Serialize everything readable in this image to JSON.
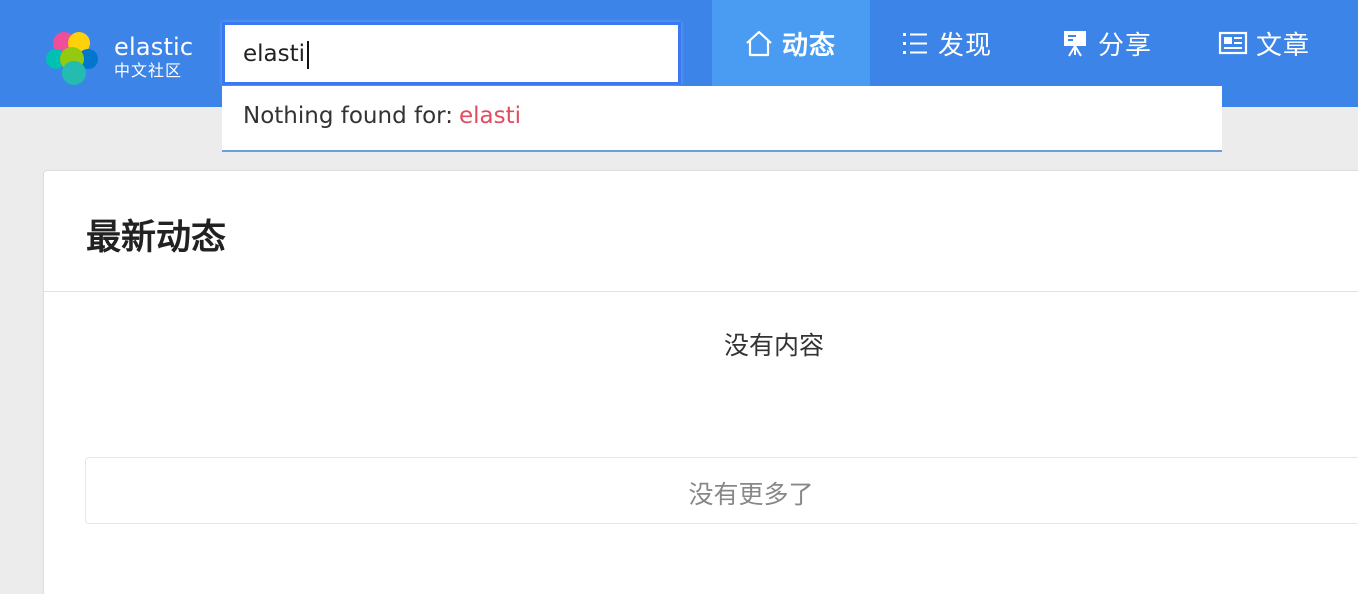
{
  "header": {
    "bg_color": "#3d84e8",
    "logo": {
      "name": "elastic",
      "subtitle": "中文社区",
      "icon": "elastic-logo-icon"
    },
    "search": {
      "value": "elasti",
      "placeholder": ""
    }
  },
  "dropdown": {
    "message": "Nothing found for:",
    "query": "elasti",
    "query_color": "#e24c5f"
  },
  "nav": {
    "items": [
      {
        "label": "动态",
        "icon": "home-icon",
        "active": true
      },
      {
        "label": "发现",
        "icon": "list-icon",
        "active": false
      },
      {
        "label": "分享",
        "icon": "presentation-icon",
        "active": false
      },
      {
        "label": "文章",
        "icon": "newspaper-icon",
        "active": false
      }
    ]
  },
  "feed": {
    "title": "最新动态",
    "empty_message": "没有内容",
    "no_more": "没有更多了"
  }
}
